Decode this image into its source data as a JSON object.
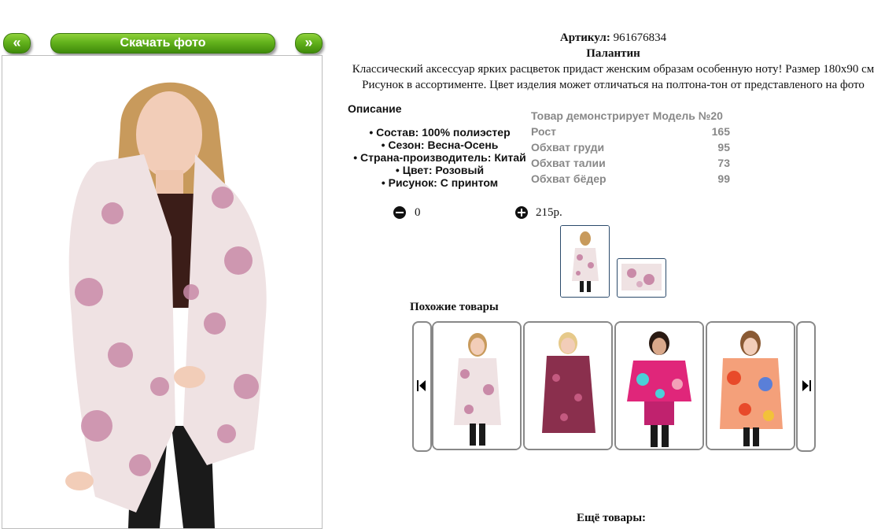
{
  "nav": {
    "prev_label": "«",
    "download_label": "Скачать фото",
    "next_label": "»"
  },
  "product": {
    "article_label": "Артикул:",
    "article_value": "961676834",
    "name": "Палантин",
    "desc_line1": "Классический аксессуар ярких расцветок придаст женским образам особенную ноту! Размер 180x90 см",
    "desc_line2": "Рисунок в ассортименте. Цвет изделия может отличаться на полтона-тон от представленого на фото"
  },
  "description": {
    "title": "Описание",
    "items": [
      "Состав: 100% полиэстер",
      "Сезон: Весна-Осень",
      "Страна-производитель: Китай",
      "Цвет: Розовый",
      "Рисунок: С принтом"
    ]
  },
  "model": {
    "title": "Товар демонстрирует Модель №20",
    "rows": [
      {
        "label": "Рост",
        "value": "165"
      },
      {
        "label": "Обхват груди",
        "value": "95"
      },
      {
        "label": "Обхват талии",
        "value": "73"
      },
      {
        "label": "Обхват бёдер",
        "value": "99"
      }
    ]
  },
  "cart": {
    "quantity": "0",
    "price": "215р."
  },
  "similar": {
    "title": "Похожие товары"
  },
  "more": {
    "title": "Ещё товары:"
  },
  "colors": {
    "accent_green": "#63b21c",
    "thumb_border": "#2b4a6b",
    "scarf_pink": "#c98aa8"
  },
  "icons": {
    "minus": "minus-circle-icon",
    "plus": "plus-circle-icon",
    "prev": "skip-back-icon",
    "next": "skip-forward-icon"
  }
}
